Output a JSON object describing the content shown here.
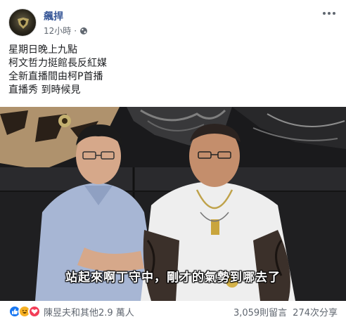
{
  "post": {
    "author": "飆捍",
    "time": "12小時",
    "privacy_icon": "globe-icon",
    "more_icon": "more-options-icon",
    "lines": [
      "星期日晚上九點",
      "柯文哲力挺館長反紅媒",
      "全新直播間由柯P首播",
      "直播秀 到時候見"
    ]
  },
  "video": {
    "subtitle": "站起來啊丁守中，剛才的氣勢到哪去了"
  },
  "footer": {
    "reaction_icons": [
      "like-icon",
      "haha-icon",
      "love-icon"
    ],
    "reaction_text": "陳昱夫和其他2.9 萬人",
    "comments": "3,059則留言",
    "shares": "274次分享"
  },
  "colors": {
    "link": "#385898",
    "meta": "#606770",
    "like": "#1877f2",
    "haha": "#f7b125",
    "love": "#f33e58"
  }
}
